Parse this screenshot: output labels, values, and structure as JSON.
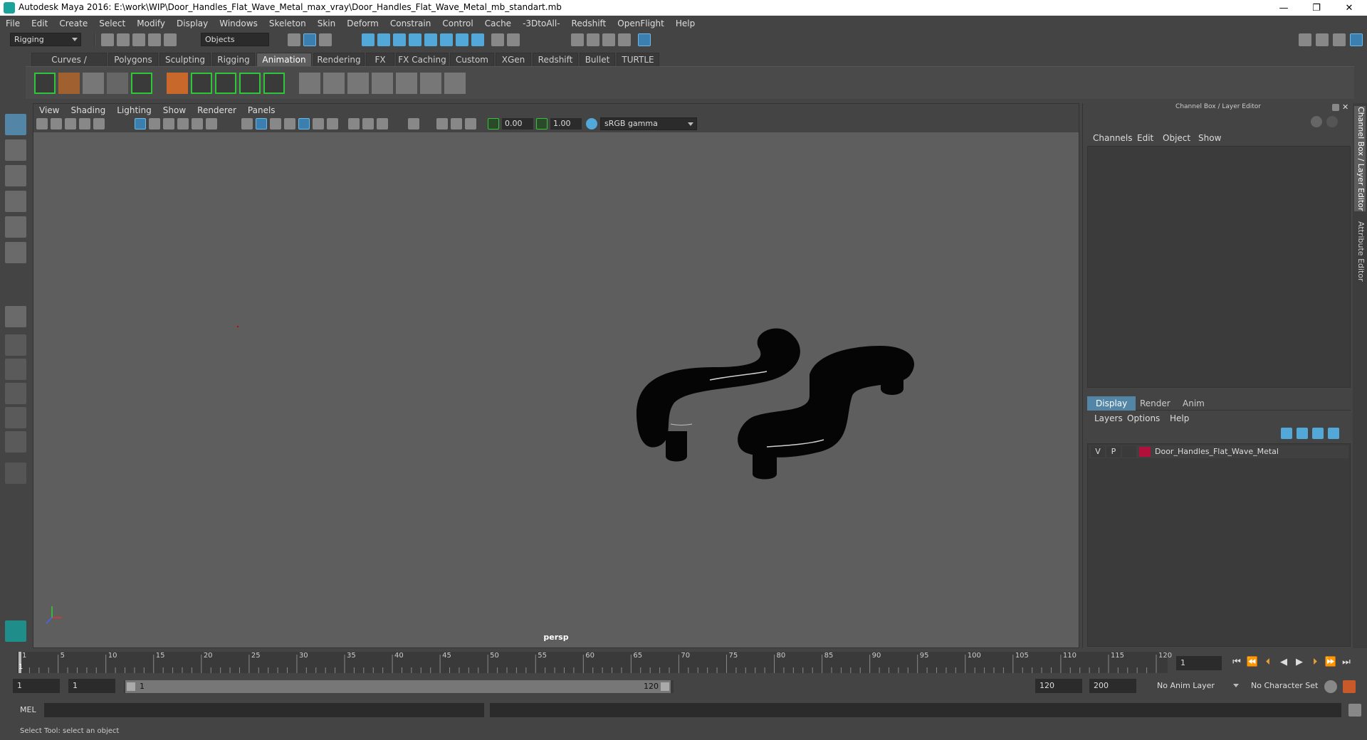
{
  "window": {
    "title": "Autodesk Maya 2016: E:\\work\\WIP\\Door_Handles_Flat_Wave_Metal_max_vray\\Door_Handles_Flat_Wave_Metal_mb_standart.mb",
    "controls": {
      "minimize": "—",
      "restore": "❐",
      "close": "✕"
    }
  },
  "menubar": [
    "File",
    "Edit",
    "Create",
    "Select",
    "Modify",
    "Display",
    "Windows",
    "Skeleton",
    "Skin",
    "Deform",
    "Constrain",
    "Control",
    "Cache",
    "-3DtoAll-",
    "Redshift",
    "OpenFlight",
    "Help"
  ],
  "statusline": {
    "mode": "Rigging",
    "selection_mode": "Objects"
  },
  "shelf_tabs": [
    "Curves / Surfaces",
    "Polygons",
    "Sculpting",
    "Rigging",
    "Animation",
    "Rendering",
    "FX",
    "FX Caching",
    "Custom",
    "XGen",
    "Redshift",
    "Bullet",
    "TURTLE"
  ],
  "shelf_active": "Animation",
  "viewport": {
    "menu": [
      "View",
      "Shading",
      "Lighting",
      "Show",
      "Renderer",
      "Panels"
    ],
    "exposure": "0.00",
    "gamma": "1.00",
    "color_space": "sRGB gamma",
    "camera_label": "persp"
  },
  "right_panel": {
    "title": "Channel Box / Layer Editor",
    "channel_menu": [
      "Channels",
      "Edit",
      "Object",
      "Show"
    ],
    "layer_tabs": [
      "Display",
      "Render",
      "Anim"
    ],
    "layer_active": "Display",
    "layer_menu": [
      "Layers",
      "Options",
      "Help"
    ],
    "layer": {
      "v": "V",
      "p": "P",
      "name": "Door_Handles_Flat_Wave_Metal",
      "color": "#b0103a"
    },
    "side_tabs": [
      "Channel Box / Layer Editor",
      "Attribute Editor"
    ]
  },
  "timeslider": {
    "ticks": [
      "1",
      "5",
      "10",
      "15",
      "20",
      "25",
      "30",
      "35",
      "40",
      "45",
      "50",
      "55",
      "60",
      "65",
      "70",
      "75",
      "80",
      "85",
      "90",
      "95",
      "100",
      "105",
      "110",
      "115",
      "120"
    ],
    "current_frame": "1"
  },
  "range": {
    "start": "1",
    "playback_start": "1",
    "slider_start": "1",
    "slider_end": "120",
    "playback_end": "120",
    "end": "200",
    "anim_layer": "No Anim Layer",
    "character_set": "No Character Set"
  },
  "command": {
    "label": "MEL"
  },
  "help_line": "Select Tool: select an object"
}
